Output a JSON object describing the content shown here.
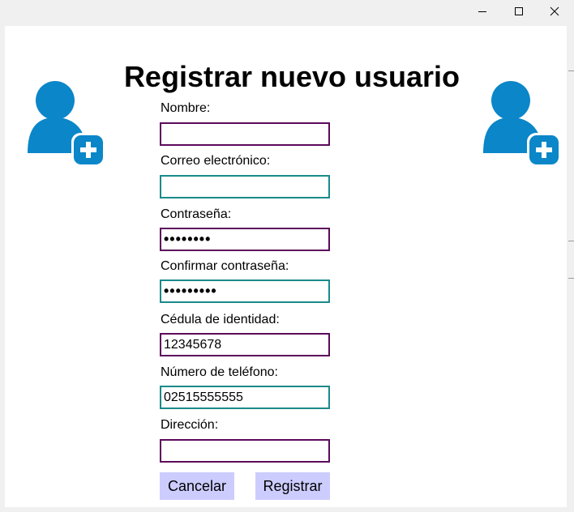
{
  "window": {
    "controls": [
      "minimize",
      "maximize",
      "close"
    ]
  },
  "form": {
    "title": "Registrar nuevo usuario",
    "fields": [
      {
        "label": "Nombre:",
        "value": ""
      },
      {
        "label": "Correo electrónico:",
        "value": ""
      },
      {
        "label": "Contraseña:",
        "value": "••••••••"
      },
      {
        "label": "Confirmar contraseña:",
        "value": "•••••••••"
      },
      {
        "label": "Cédula de identidad:",
        "value": "12345678"
      },
      {
        "label": "Número de teléfono:",
        "value": "02515555555"
      },
      {
        "label": "Dirección:",
        "value": ""
      }
    ],
    "cancel_label": "Cancelar",
    "submit_label": "Registrar"
  },
  "icons": {
    "left": "add-user-icon",
    "right": "add-user-icon"
  },
  "colors": {
    "icon_blue": "#0a86c9",
    "button_bg": "#ccccff",
    "border_purple": "#5c0a5c",
    "border_teal": "#1a8a8a"
  }
}
